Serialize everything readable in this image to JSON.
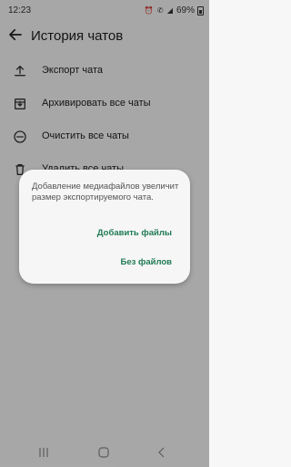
{
  "status_bar": {
    "time": "12:23",
    "battery": "69%"
  },
  "app_bar": {
    "title": "История чатов"
  },
  "menu": {
    "items": [
      {
        "label": "Экспорт чата",
        "icon": "upload-icon"
      },
      {
        "label": "Архивировать все чаты",
        "icon": "archive-icon"
      },
      {
        "label": "Очистить все чаты",
        "icon": "minus-circle-icon"
      },
      {
        "label": "Удалить все чаты",
        "icon": "trash-icon"
      }
    ]
  },
  "dialog": {
    "message": "Добавление медиафайлов увеличит размер экспортируемого чата.",
    "add_files_label": "Добавить файлы",
    "no_files_label": "Без файлов"
  },
  "colors": {
    "accent": "#1f7a55",
    "scrim": "rgba(0,0,0,0.32)"
  }
}
